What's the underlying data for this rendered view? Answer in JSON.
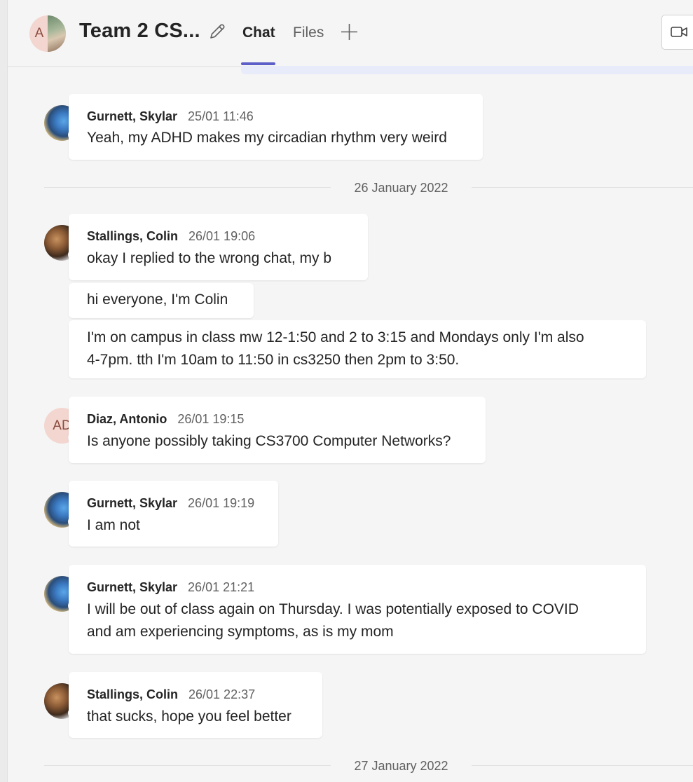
{
  "header": {
    "group_initial": "A",
    "title": "Team 2 CS...",
    "tabs": [
      {
        "label": "Chat",
        "active": true
      },
      {
        "label": "Files",
        "active": false
      }
    ]
  },
  "colors": {
    "accent": "#5b5fc7",
    "available": "#6bb700",
    "away": "#f8c00a"
  },
  "messages": [
    {
      "sender": "Gurnett, Skylar",
      "time": "25/01 11:46",
      "text": [
        "Yeah, my ADHD makes my circadian rhythm very weird"
      ],
      "presence": "away"
    },
    {
      "sender": "Stallings, Colin",
      "time": "26/01 19:06",
      "text": [
        "okay I replied to the wrong chat, my b"
      ],
      "presence": "available"
    },
    {
      "text": [
        "hi everyone, I'm Colin"
      ]
    },
    {
      "text": [
        "I'm on campus in class mw 12-1:50 and 2 to 3:15 and Mondays only I'm also",
        "4-7pm. tth I'm 10am to 11:50 in cs3250 then 2pm to 3:50."
      ]
    },
    {
      "sender": "Diaz, Antonio",
      "initials": "AD",
      "time": "26/01 19:15",
      "text": [
        "Is anyone possibly taking CS3700 Computer Networks?"
      ],
      "presence": "available"
    },
    {
      "sender": "Gurnett, Skylar",
      "time": "26/01 19:19",
      "text": [
        "I am not"
      ],
      "presence": "away"
    },
    {
      "sender": "Gurnett, Skylar",
      "time": "26/01 21:21",
      "text": [
        "I will be out of class again on Thursday. I was potentially exposed to COVID",
        "and am experiencing symptoms, as is my mom"
      ],
      "presence": "away"
    },
    {
      "sender": "Stallings, Colin",
      "time": "26/01 22:37",
      "text": [
        "that sucks, hope you feel better"
      ],
      "presence": "available"
    }
  ],
  "date_dividers": [
    "26 January 2022",
    "27 January 2022"
  ]
}
